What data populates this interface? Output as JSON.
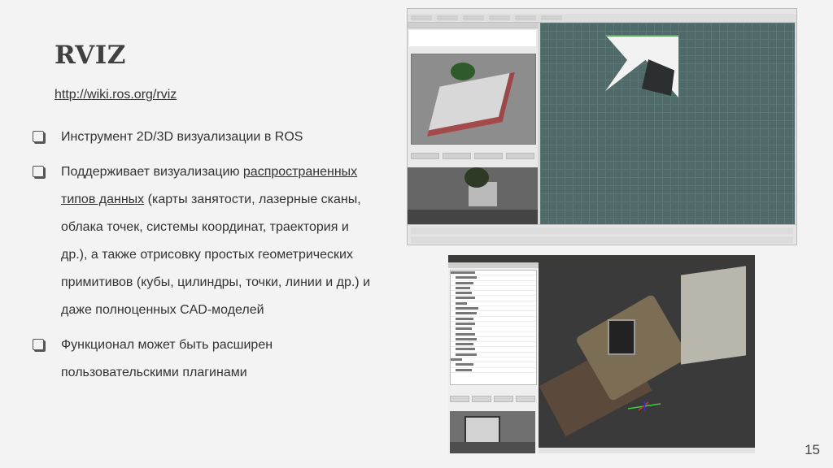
{
  "slide": {
    "title": "RVIZ",
    "url": "http://wiki.ros.org/rviz",
    "page_number": "15"
  },
  "bullets": [
    {
      "text": "Инструмент 2D/3D визуализации в ROS"
    },
    {
      "before": "Поддерживает визуализацию ",
      "link": "распространенных типов данных",
      "after": " (карты занятости, лазерные сканы, облака точек, системы координат, траектория и др.), а также отрисовку простых геометрических примитивов (кубы, цилиндры, точки, линии и др.) и даже полноценных CAD-моделей"
    },
    {
      "text": "Функционал может быть расширен пользовательскими плагинами"
    }
  ],
  "colors": {
    "background": "#f3f3f3",
    "title": "#404040",
    "text": "#333333",
    "grid": "#4f6a68"
  }
}
